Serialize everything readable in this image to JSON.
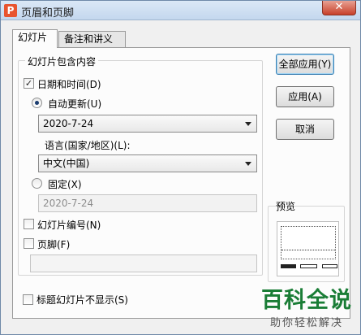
{
  "window": {
    "title": "页眉和页脚",
    "app_icon_glyph": "P",
    "close_glyph": "✕"
  },
  "tabs": [
    {
      "label": "幻灯片",
      "active": true
    },
    {
      "label": "备注和讲义",
      "active": false
    }
  ],
  "slide_contents": {
    "legend": "幻灯片包含内容",
    "date_time": {
      "label": "日期和时间(D)",
      "checked": true,
      "auto_update": {
        "label": "自动更新(U)",
        "selected": true,
        "value": "2020-7-24"
      },
      "language": {
        "label": "语言(国家/地区)(L):",
        "value": "中文(中国)"
      },
      "fixed": {
        "label": "固定(X)",
        "selected": false,
        "value": "2020-7-24"
      }
    },
    "slide_number": {
      "label": "幻灯片编号(N)",
      "checked": false
    },
    "footer": {
      "label": "页脚(F)",
      "checked": false,
      "value": ""
    }
  },
  "dont_show_on_title": {
    "label": "标题幻灯片不显示(S)",
    "checked": false
  },
  "buttons": {
    "apply_all": "全部应用(Y)",
    "apply": "应用(A)",
    "cancel": "取消"
  },
  "preview": {
    "label": "预览"
  },
  "watermark": {
    "main": "百科全说",
    "sub": "助你轻松解决"
  },
  "icons": {
    "checkbox_checked": "✓",
    "dropdown": "chevron-down-icon"
  }
}
